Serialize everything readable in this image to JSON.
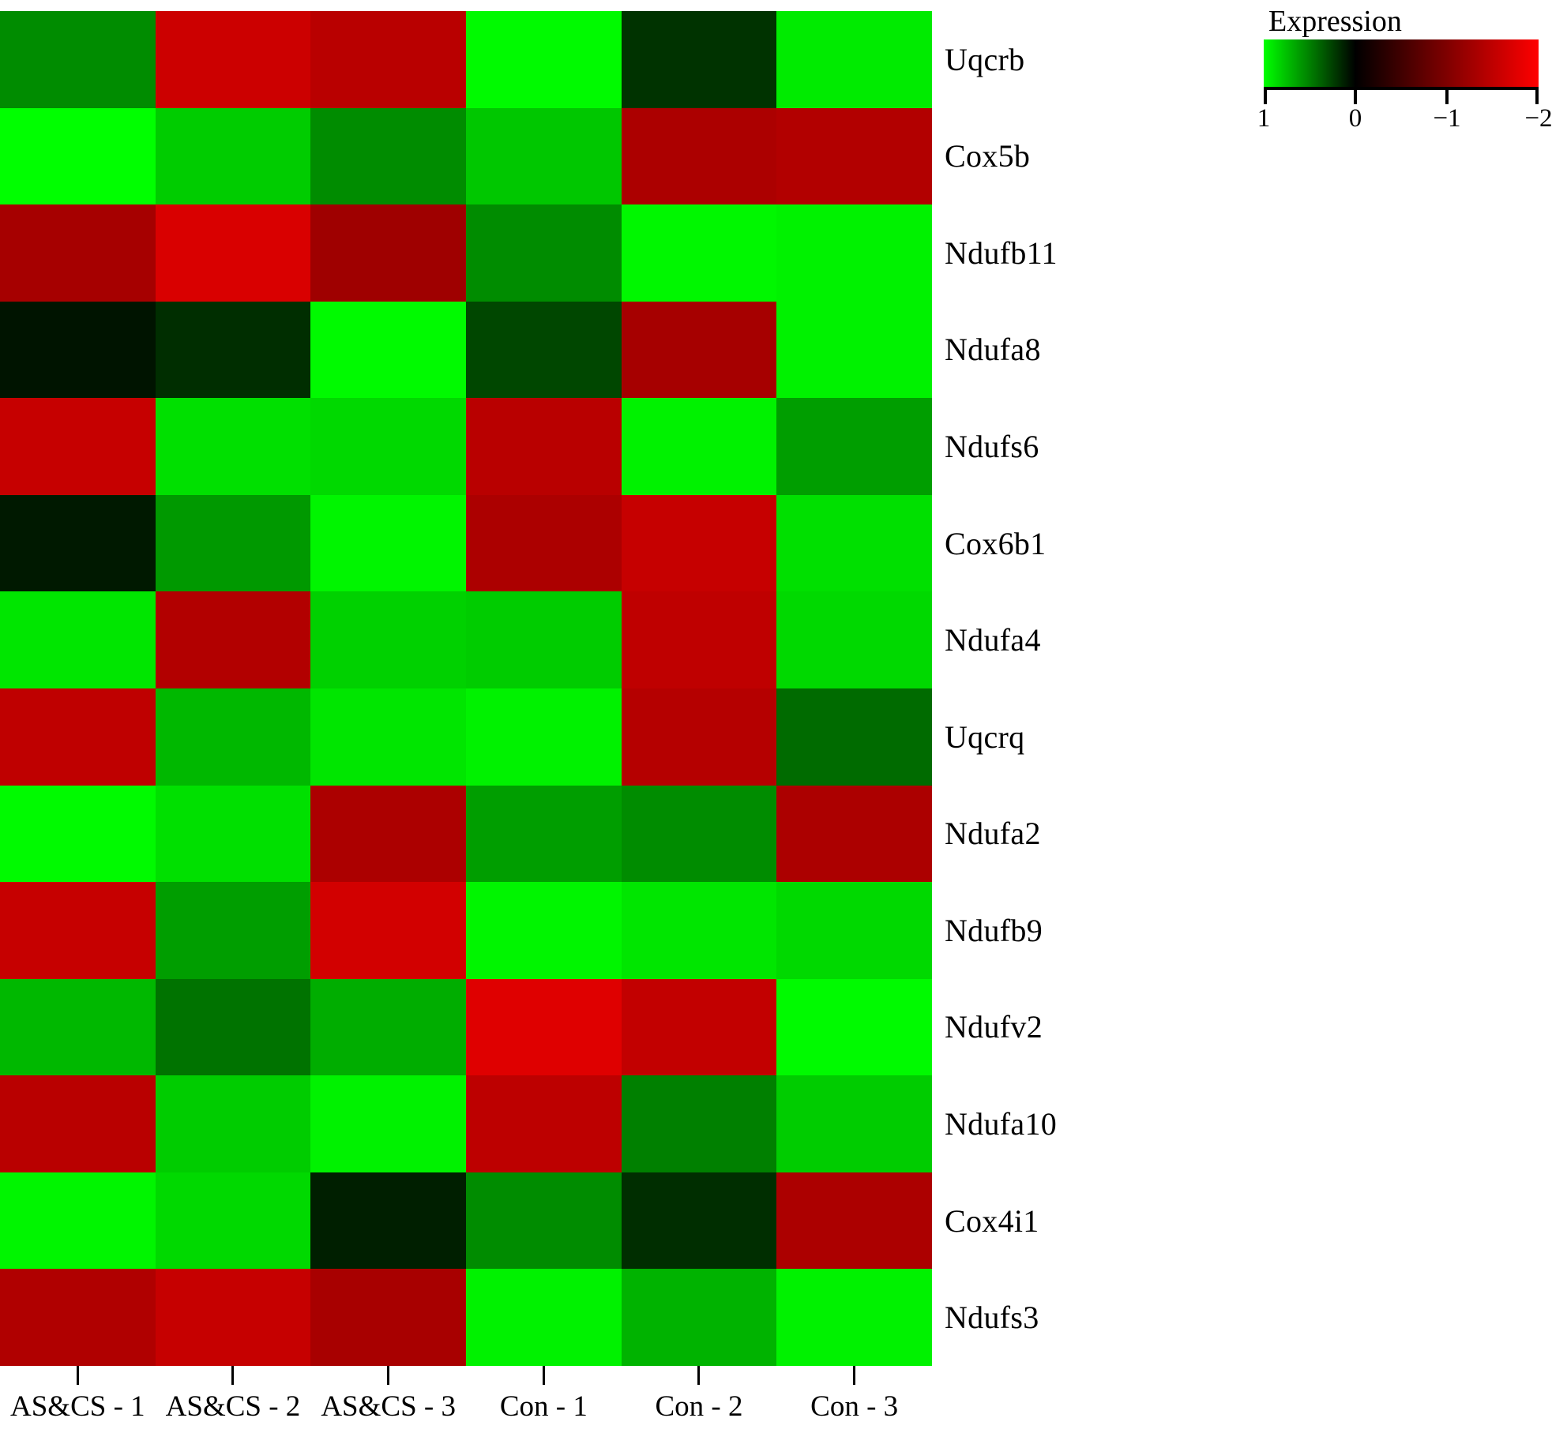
{
  "legend": {
    "title": "Expression",
    "ticks": [
      "1",
      "0",
      "−1",
      "−2"
    ],
    "tick_positions": [
      0,
      33.33,
      66.67,
      100
    ],
    "vmax": 1,
    "vmin": -2,
    "high_color": "#00ff00",
    "mid_color": "#000000",
    "low_color": "#ff0000",
    "orientation": "horizontal"
  },
  "columns": [
    "AS&CS - 1",
    "AS&CS - 2",
    "AS&CS - 3",
    "Con - 1",
    "Con - 2",
    "Con - 3"
  ],
  "rows": [
    "Uqcrb",
    "Cox5b",
    "Ndufb11",
    "Ndufa8",
    "Ndufs6",
    "Cox6b1",
    "Ndufa4",
    "Uqcrq",
    "Ndufa2",
    "Ndufb9",
    "Ndufv2",
    "Ndufa10",
    "Cox4i1",
    "Ndufs3"
  ],
  "chart_data": {
    "type": "heatmap",
    "title": "",
    "xlabel": "",
    "ylabel": "",
    "colorbar_label": "Expression",
    "colormap": "green-black-red (reversed: high=green, low=red)",
    "vmin": -2,
    "vmax": 1,
    "grid": false,
    "legend_position": "top-right",
    "categories": [
      "AS&CS - 1",
      "AS&CS - 2",
      "AS&CS - 3",
      "Con - 1",
      "Con - 2",
      "Con - 3"
    ],
    "row_labels": [
      "Uqcrb",
      "Cox5b",
      "Ndufb11",
      "Ndufa8",
      "Ndufs6",
      "Cox6b1",
      "Ndufa4",
      "Uqcrq",
      "Ndufa2",
      "Ndufb9",
      "Ndufv2",
      "Ndufa10",
      "Cox4i1",
      "Ndufs3"
    ],
    "values": [
      [
        0.55,
        -1.6,
        -1.45,
        0.98,
        0.2,
        0.92
      ],
      [
        1.0,
        0.8,
        0.55,
        0.78,
        -1.35,
        -1.4
      ],
      [
        -1.3,
        -1.7,
        -1.25,
        0.55,
        0.97,
        0.95
      ],
      [
        0.08,
        0.18,
        0.98,
        0.28,
        -1.3,
        0.95
      ],
      [
        -1.55,
        0.88,
        0.85,
        -1.45,
        0.95,
        0.62
      ],
      [
        0.1,
        0.6,
        0.96,
        -1.35,
        -1.55,
        0.88
      ],
      [
        0.9,
        -1.4,
        0.82,
        0.8,
        -1.5,
        0.85
      ],
      [
        -1.5,
        0.72,
        0.9,
        0.95,
        -1.42,
        0.42
      ],
      [
        0.98,
        0.88,
        -1.35,
        0.62,
        0.55,
        -1.35
      ],
      [
        -1.55,
        0.62,
        -1.65,
        0.96,
        0.9,
        0.85
      ],
      [
        0.72,
        0.45,
        0.68,
        -1.75,
        -1.52,
        0.98
      ],
      [
        -1.45,
        0.8,
        0.95,
        -1.48,
        0.5,
        0.8
      ],
      [
        0.96,
        0.85,
        0.12,
        0.55,
        0.18,
        -1.35
      ],
      [
        -1.38,
        -1.55,
        -1.32,
        0.95,
        0.7,
        0.95
      ]
    ]
  }
}
